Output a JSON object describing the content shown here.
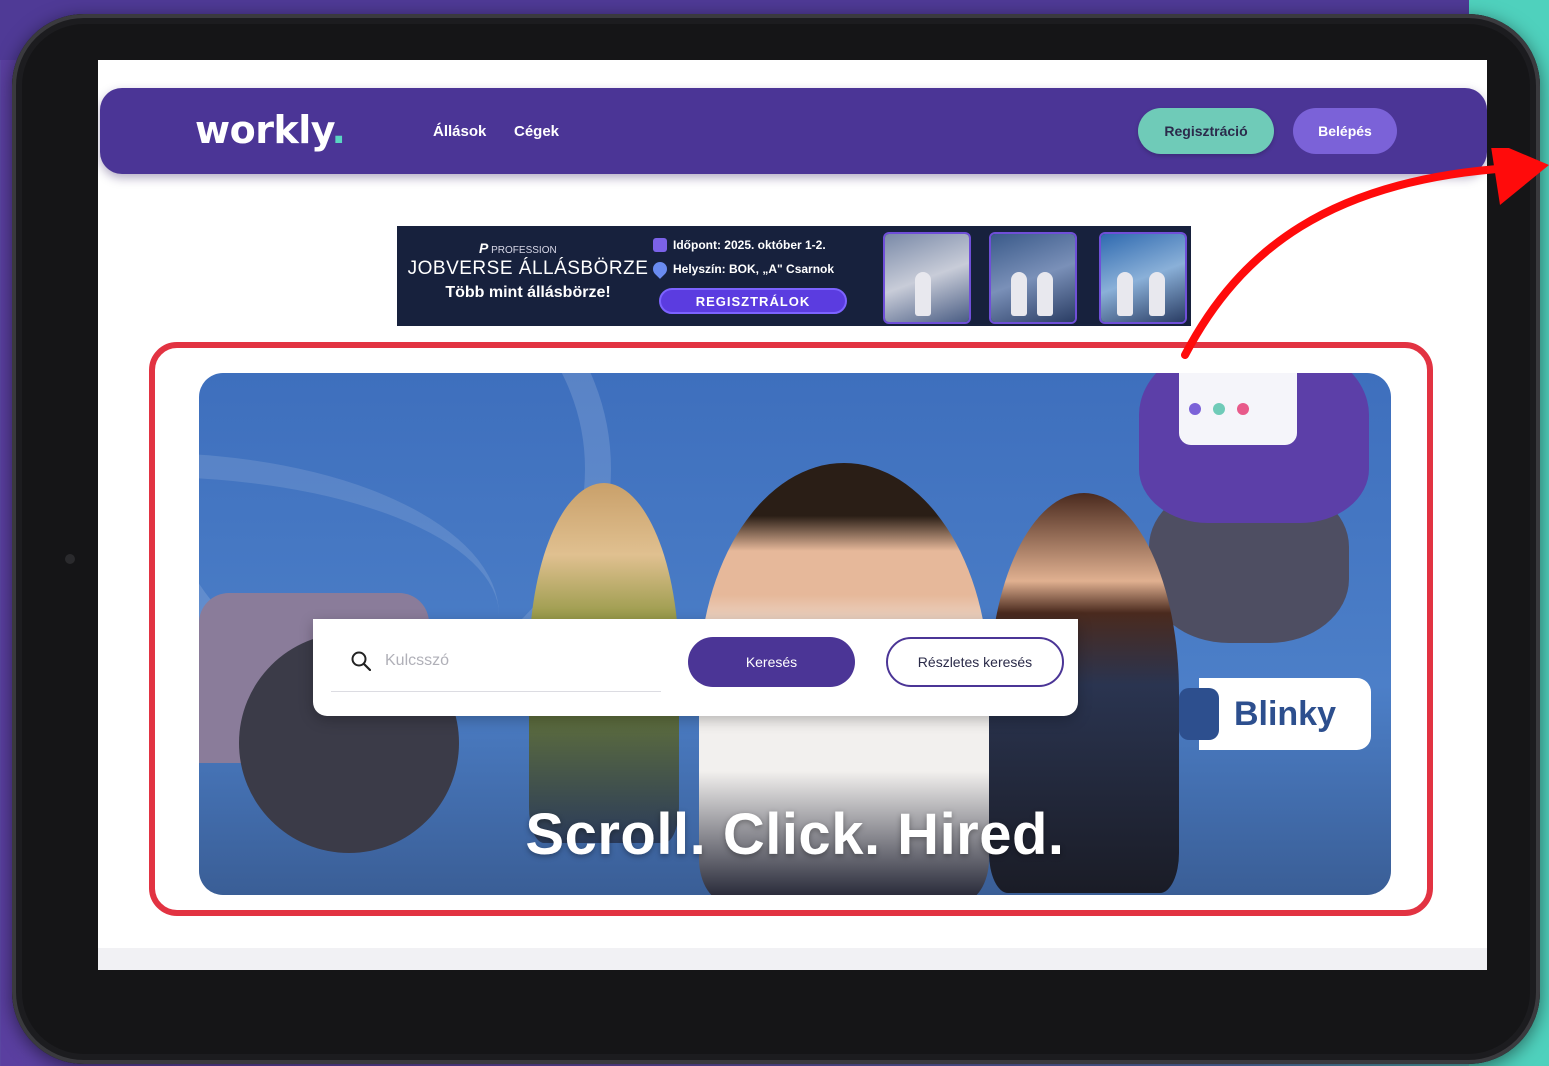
{
  "brand": {
    "logo_text": "workly",
    "logo_dot": ".",
    "accent_color": "#5ad5c2",
    "nav_color": "#4b3596"
  },
  "nav": {
    "links": [
      "Állások",
      "Cégek"
    ],
    "register_label": "Regisztráció",
    "login_label": "Belépés"
  },
  "banner": {
    "organizer": "PROFESSION",
    "title": "JOBVERSE ÁLLÁSBÖRZE",
    "subtitle": "Több mint állásbörze!",
    "date": "Időpont: 2025. október 1-2.",
    "location": "Helyszín: BOK, „A\" Csarnok",
    "cta": "REGISZTRÁLOK"
  },
  "hero": {
    "tagline": "Scroll. Click. Hired.",
    "sign_text": "Blinky",
    "mascot_dot_colors": [
      "#7b62d8",
      "#6fcbb8",
      "#e85a8a"
    ]
  },
  "search": {
    "placeholder": "Kulcsszó",
    "search_button": "Keresés",
    "advanced_button": "Részletes keresés"
  },
  "annotation": {
    "highlight_color": "#e23342"
  }
}
